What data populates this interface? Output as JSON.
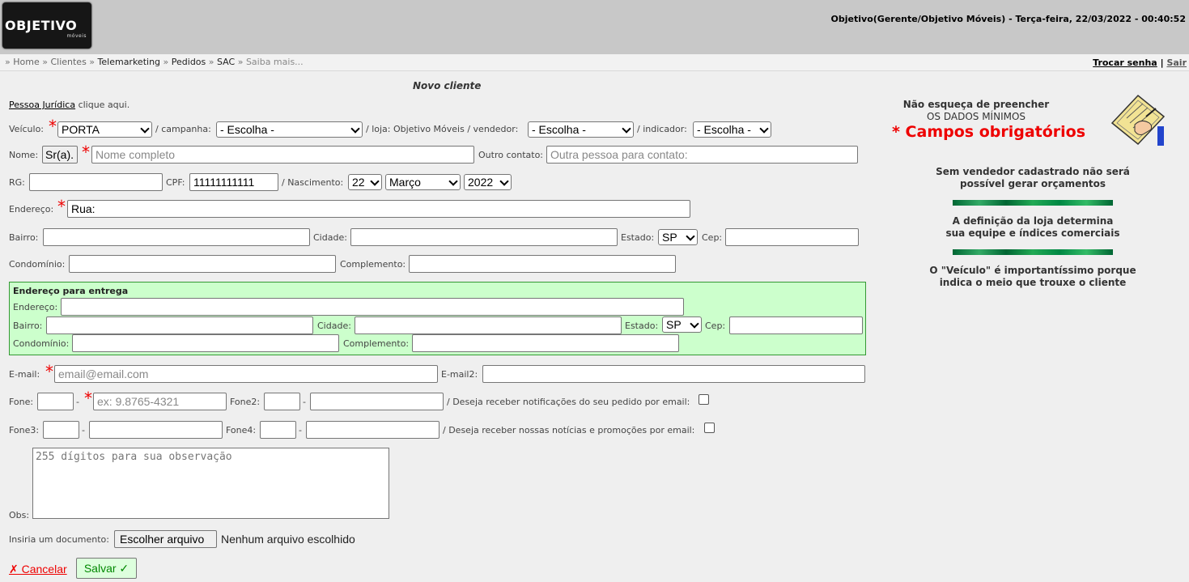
{
  "header": {
    "logo_main": "OBJETIVO",
    "logo_sub": "móveis",
    "user_info": "Objetivo(Gerente/Objetivo Móveis) - Terça-feira, 22/03/2022 - 00:40:52"
  },
  "breadcrumb": {
    "items": [
      "Home",
      "Clientes",
      "Telemarketing",
      "Pedidos",
      "SAC",
      "Saiba mais..."
    ],
    "sep": "»"
  },
  "top_links": {
    "change_password": "Trocar senha",
    "divider": "|",
    "logout": "Sair"
  },
  "form": {
    "title": "Novo cliente",
    "pj_link": "Pessoa Jurídica",
    "pj_suffix": "clique aqui.",
    "veiculo_label": "Veículo:",
    "veiculo_value": "PORTA",
    "campanha_label": "/ campanha:",
    "campanha_value": "- Escolha -",
    "loja_label": "/ loja: Objetivo Móveis / vendedor:",
    "vendedor_value": "- Escolha -",
    "indicador_label": "/ indicador:",
    "indicador_value": "- Escolha -",
    "nome_label": "Nome:",
    "nome_prefix": "Sr(a).",
    "nome_placeholder": "Nome completo",
    "outro_contato_label": "Outro contato:",
    "outro_contato_placeholder": "Outra pessoa para contato:",
    "rg_label": "RG:",
    "cpf_label": "CPF:",
    "cpf_value": "11111111111",
    "nascimento_label": "/ Nascimento:",
    "dia_value": "22",
    "mes_value": "Março",
    "ano_value": "2022",
    "endereco_label": "Endereço:",
    "endereco_value": "Rua:",
    "bairro_label": "Bairro:",
    "cidade_label": "Cidade:",
    "estado_label": "Estado:",
    "estado_value": "SP",
    "cep_label": "Cep:",
    "condominio_label": "Condomínio:",
    "complemento_label": "Complemento:",
    "entrega": {
      "title": "Endereço para entrega",
      "endereco_label": "Endereço:",
      "bairro_label": "Bairro:",
      "cidade_label": "Cidade:",
      "estado_label": "Estado:",
      "estado_value": "SP",
      "cep_label": "Cep:",
      "condominio_label": "Condomínio:",
      "complemento_label": "Complemento:"
    },
    "email_label": "E-mail:",
    "email_placeholder": "email@email.com",
    "email2_label": "E-mail2:",
    "fone_label": "Fone:",
    "fone_placeholder": "ex: 9.8765-4321",
    "fone2_label": "Fone2:",
    "dash": "-",
    "notif_label": "/ Deseja receber notificações do seu pedido por email:",
    "fone3_label": "Fone3:",
    "fone4_label": "Fone4:",
    "promo_label": "/ Deseja receber nossas notícias e promoções por email:",
    "obs_label": "Obs:",
    "obs_placeholder": "255 dígitos para sua observação",
    "doc_label": "Insiria um documento:",
    "doc_button": "Escolher arquivo",
    "doc_status": "Nenhum arquivo escolhido",
    "cancel_label": "✗ Cancelar",
    "save_label": "Salvar ✓",
    "required_mark": "*"
  },
  "side": {
    "line1": "Não esqueça de preencher",
    "line2": "OS DADOS MÍNIMOS",
    "required_title": "* Campos obrigatórios",
    "tip1_a": "Sem vendedor cadastrado não será",
    "tip1_b": "possível gerar orçamentos",
    "tip2_a": "A definição da loja determina",
    "tip2_b": "sua equipe e índices comerciais",
    "tip3_a": "O \"Veículo\" é importantíssimo porque",
    "tip3_b": "indica o meio que trouxe o cliente"
  },
  "colors": {
    "required": "#ee0000",
    "delivery_bg": "#ccffcc",
    "header_bg": "#c8c8c8"
  }
}
